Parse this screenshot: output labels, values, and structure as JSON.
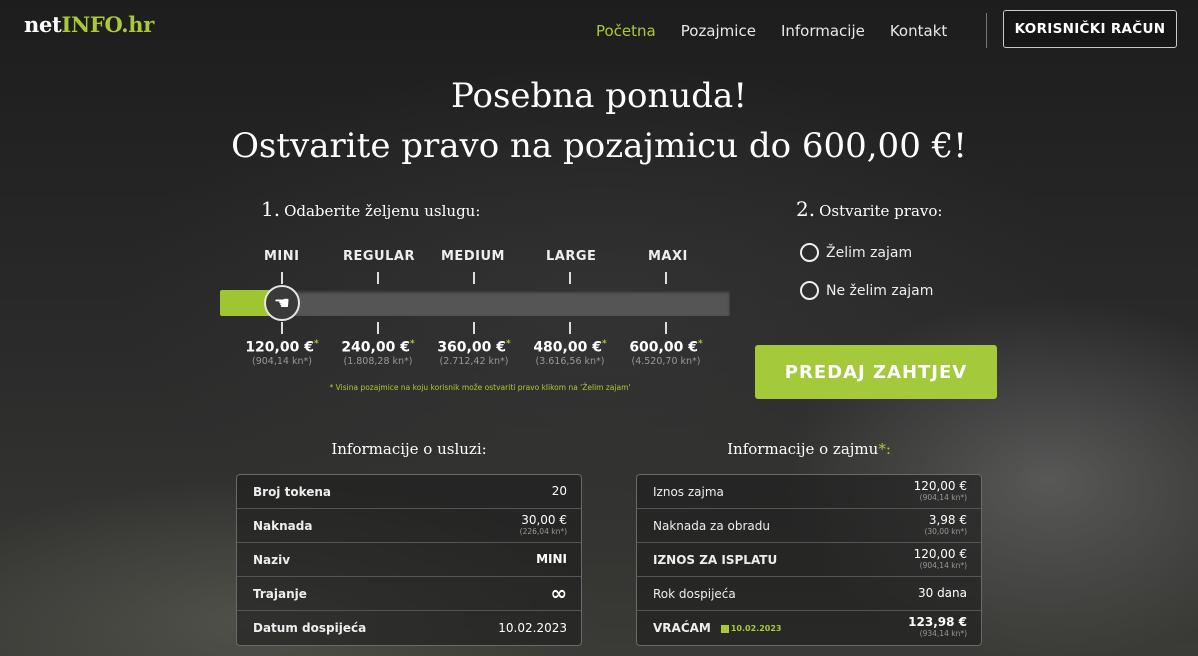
{
  "header": {
    "logo_prefix": "net",
    "logo_accent": "INFO.hr",
    "nav": [
      "Početna",
      "Pozajmice",
      "Informacije",
      "Kontakt"
    ],
    "active_nav": "Početna",
    "account_button": "KORISNIČKI RAČUN"
  },
  "hero": {
    "line1": "Posebna ponuda!",
    "line2": "Ostvarite pravo na pozajmicu do 600,00 €!"
  },
  "step1": {
    "number": "1.",
    "label": "Odaberite željenu uslugu:"
  },
  "step2": {
    "number": "2.",
    "label": "Ostvarite pravo:"
  },
  "slider": {
    "tiers": [
      "MINI",
      "REGULAR",
      "MEDIUM",
      "LARGE",
      "MAXI"
    ],
    "prices": [
      "120,00 €",
      "240,00 €",
      "360,00 €",
      "480,00 €",
      "600,00 €"
    ],
    "kunas": [
      "(904,14 kn*)",
      "(1.808,28 kn*)",
      "(2.712,42 kn*)",
      "(3.616,56 kn*)",
      "(4.520,70 kn*)"
    ],
    "price_star": "*",
    "selected_index": 0,
    "note": "* Visina pozajmice na koju korisnik može ostvariti pravo klikom na 'Želim zajam'"
  },
  "options": {
    "yes": "Želim zajam",
    "no": "Ne želim zajam"
  },
  "submit_label": "PREDAJ ZAHTJEV",
  "service_info": {
    "title": "Informacije o usluzi:",
    "rows": [
      {
        "label": "Broj tokena",
        "value": "20",
        "sub": ""
      },
      {
        "label": "Naknada",
        "value": "30,00 €",
        "sub": "(226,04 kn*)"
      },
      {
        "label": "Naziv",
        "value": "MINI",
        "sub": ""
      },
      {
        "label": "Trajanje",
        "value": "∞",
        "sub": ""
      },
      {
        "label": "Datum dospijeća",
        "value": "10.02.2023",
        "sub": ""
      }
    ]
  },
  "loan_info": {
    "title": "Informacije o zajmu",
    "title_star": "*:",
    "rows": [
      {
        "label": "Iznos zajma",
        "value": "120,00 €",
        "sub": "(904,14 kn*)"
      },
      {
        "label": "Naknada za obradu",
        "value": "3,98 €",
        "sub": "(30,00 kn*)"
      },
      {
        "label": "IZNOS ZA ISPLATU",
        "value": "120,00 €",
        "sub": "(904,14 kn*)"
      },
      {
        "label": "Rok dospijeća",
        "value": "30 dana",
        "sub": ""
      },
      {
        "label": "VRAĆAM",
        "value": "123,98 €",
        "sub": "(934,14 kn*)",
        "date": "10.02.2023"
      }
    ]
  },
  "colors": {
    "accent": "#a9c93a",
    "button": "#a4c93a"
  }
}
